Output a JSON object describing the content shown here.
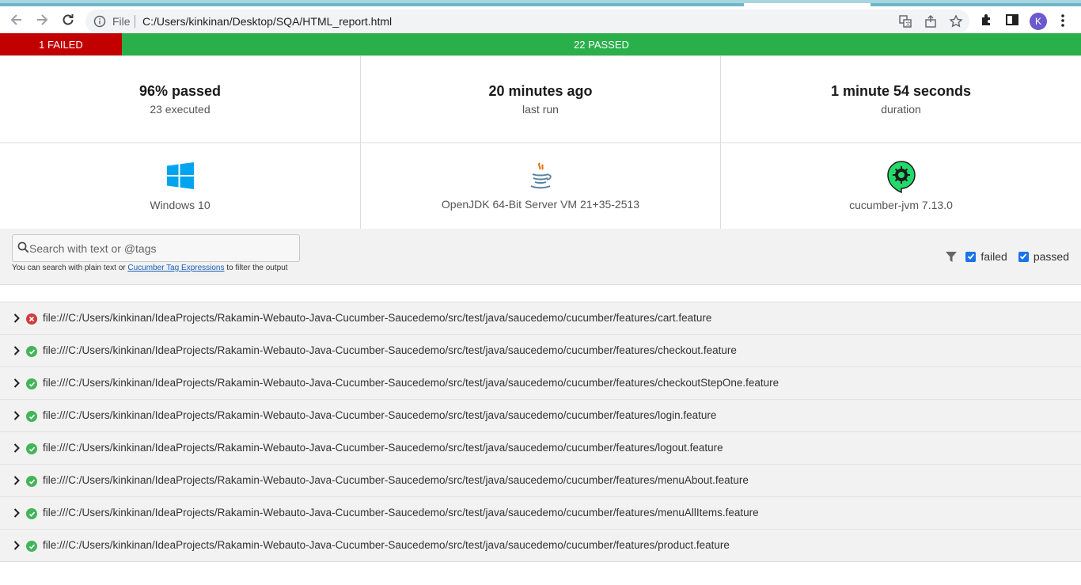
{
  "browser": {
    "file_label": "File",
    "url": "C:/Users/kinkinan/Desktop/SQA/HTML_report.html",
    "avatar_letter": "K"
  },
  "status": {
    "failed_label": "1 FAILED",
    "passed_label": "22 PASSED",
    "failed_color": "#c20000",
    "passed_color": "#2ab04a"
  },
  "summary": {
    "passed_percent": "96% passed",
    "executed": "23 executed",
    "last_run_value": "20 minutes ago",
    "last_run_label": "last run",
    "duration_value": "1 minute 54 seconds",
    "duration_label": "duration"
  },
  "environment": {
    "os": "Windows 10",
    "os_icon": "windows-icon",
    "jvm": "OpenJDK 64-Bit Server VM 21+35-2513",
    "jvm_icon": "java-icon",
    "runner": "cucumber-jvm 7.13.0",
    "runner_icon": "cucumber-icon"
  },
  "search": {
    "placeholder": "Search with text or @tags",
    "help_prefix": "You can search with plain text or ",
    "help_link": "Cucumber Tag Expressions",
    "help_suffix": " to filter the output"
  },
  "filter": {
    "failed_label": "failed",
    "passed_label": "passed"
  },
  "features": [
    {
      "path": "file:///C:/Users/kinkinan/IdeaProjects/Rakamin-Webauto-Java-Cucumber-Saucedemo/src/test/java/saucedemo/cucumber/features/cart.feature",
      "status": "failed"
    },
    {
      "path": "file:///C:/Users/kinkinan/IdeaProjects/Rakamin-Webauto-Java-Cucumber-Saucedemo/src/test/java/saucedemo/cucumber/features/checkout.feature",
      "status": "passed"
    },
    {
      "path": "file:///C:/Users/kinkinan/IdeaProjects/Rakamin-Webauto-Java-Cucumber-Saucedemo/src/test/java/saucedemo/cucumber/features/checkoutStepOne.feature",
      "status": "passed"
    },
    {
      "path": "file:///C:/Users/kinkinan/IdeaProjects/Rakamin-Webauto-Java-Cucumber-Saucedemo/src/test/java/saucedemo/cucumber/features/login.feature",
      "status": "passed"
    },
    {
      "path": "file:///C:/Users/kinkinan/IdeaProjects/Rakamin-Webauto-Java-Cucumber-Saucedemo/src/test/java/saucedemo/cucumber/features/logout.feature",
      "status": "passed"
    },
    {
      "path": "file:///C:/Users/kinkinan/IdeaProjects/Rakamin-Webauto-Java-Cucumber-Saucedemo/src/test/java/saucedemo/cucumber/features/menuAbout.feature",
      "status": "passed"
    },
    {
      "path": "file:///C:/Users/kinkinan/IdeaProjects/Rakamin-Webauto-Java-Cucumber-Saucedemo/src/test/java/saucedemo/cucumber/features/menuAllItems.feature",
      "status": "passed"
    },
    {
      "path": "file:///C:/Users/kinkinan/IdeaProjects/Rakamin-Webauto-Java-Cucumber-Saucedemo/src/test/java/saucedemo/cucumber/features/product.feature",
      "status": "passed"
    }
  ]
}
